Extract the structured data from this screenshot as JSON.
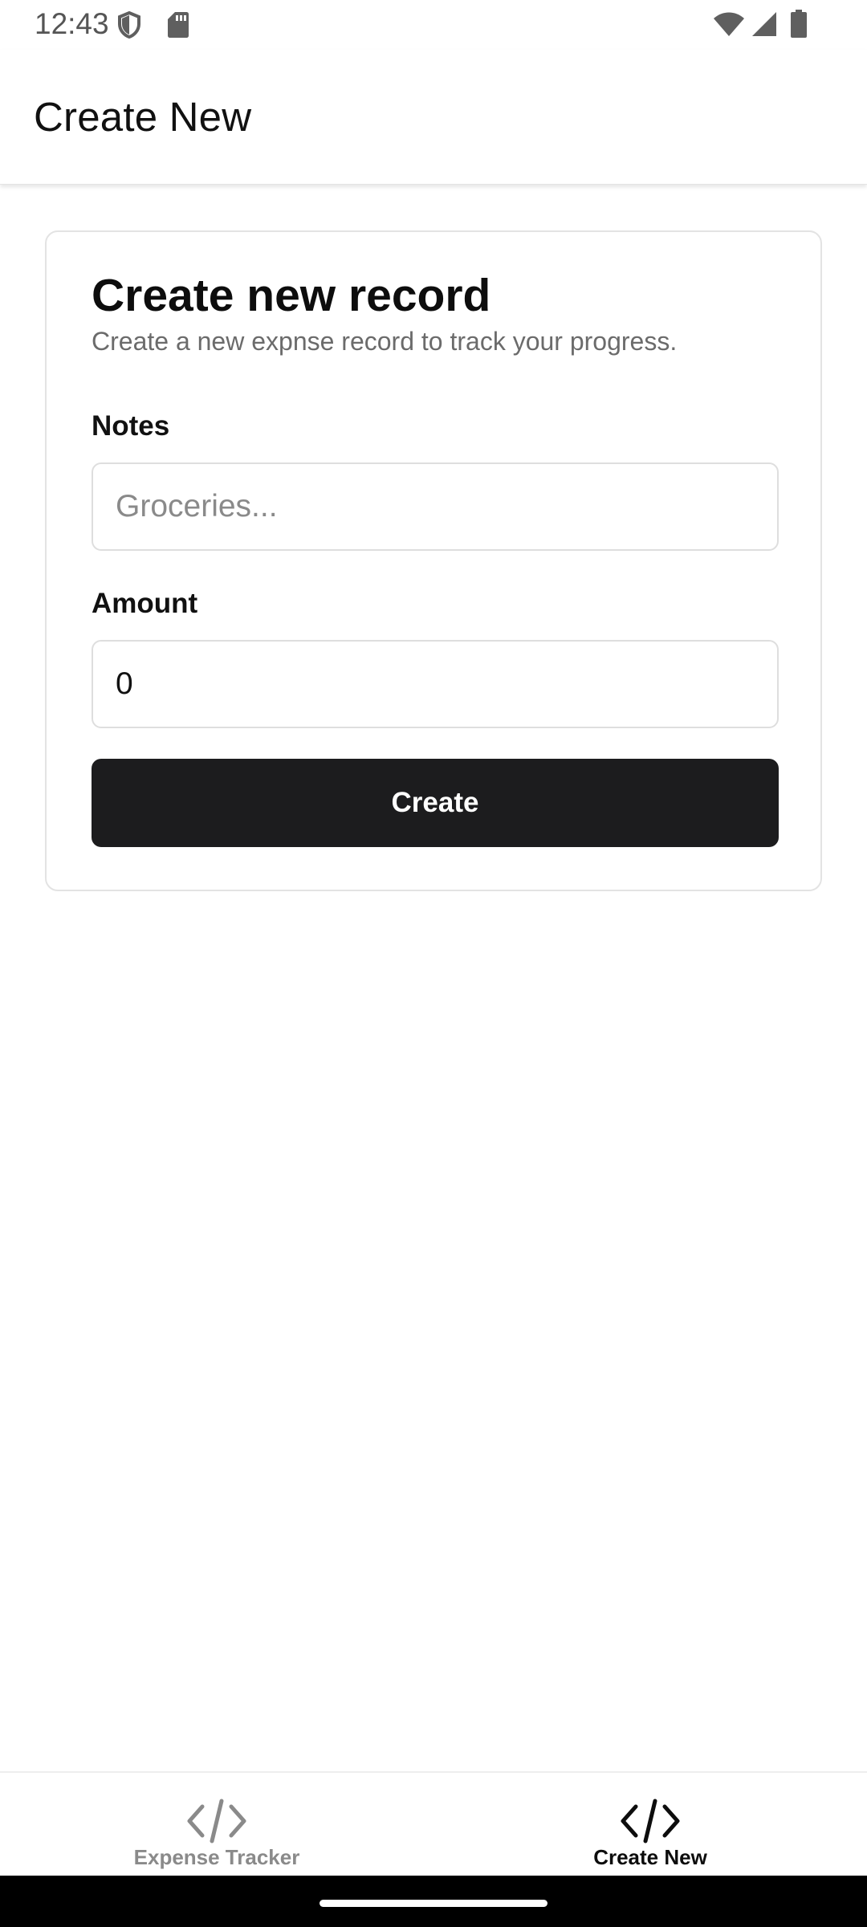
{
  "status_bar": {
    "time": "12:43",
    "icons": [
      "shield-icon",
      "sd-card-icon",
      "wifi-icon",
      "signal-icon",
      "battery-icon"
    ]
  },
  "app_bar": {
    "title": "Create New"
  },
  "form": {
    "title": "Create new record",
    "description": "Create a new expnse record to track your progress.",
    "notes": {
      "label": "Notes",
      "value": "",
      "placeholder": "Groceries..."
    },
    "amount": {
      "label": "Amount",
      "value": "0"
    },
    "submit_label": "Create"
  },
  "bottom_nav": {
    "items": [
      {
        "label": "Expense Tracker",
        "icon": "code-icon",
        "active": false
      },
      {
        "label": "Create New",
        "icon": "code-icon",
        "active": true
      }
    ]
  },
  "colors": {
    "primary_button": "#1c1c1e",
    "inactive_nav": "#8a8a8a",
    "active_nav": "#0d0d0d"
  }
}
